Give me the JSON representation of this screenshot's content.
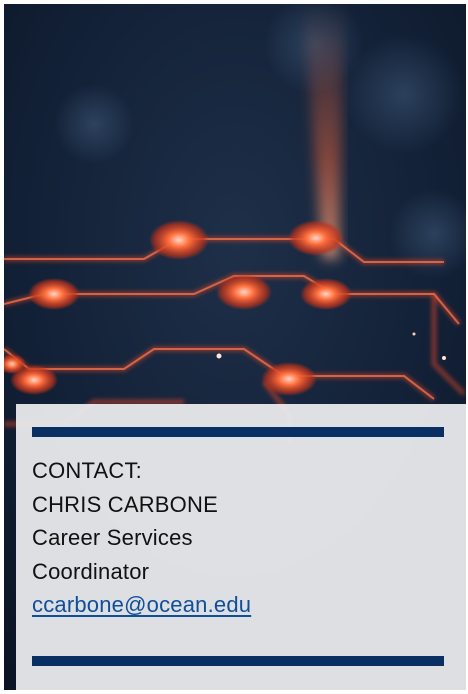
{
  "contact": {
    "heading": "CONTACT:",
    "name": "CHRIS CARBONE",
    "title_line1": "Career Services",
    "title_line2": "Coordinator",
    "email": "ccarbone@ocean.edu"
  },
  "colors": {
    "rule": "#0a2f63",
    "link": "#0f4f9a",
    "panel": "#ebecee",
    "hero_glow": "#ff5a2a"
  },
  "hero": {
    "icon": "circuit-board-image"
  }
}
